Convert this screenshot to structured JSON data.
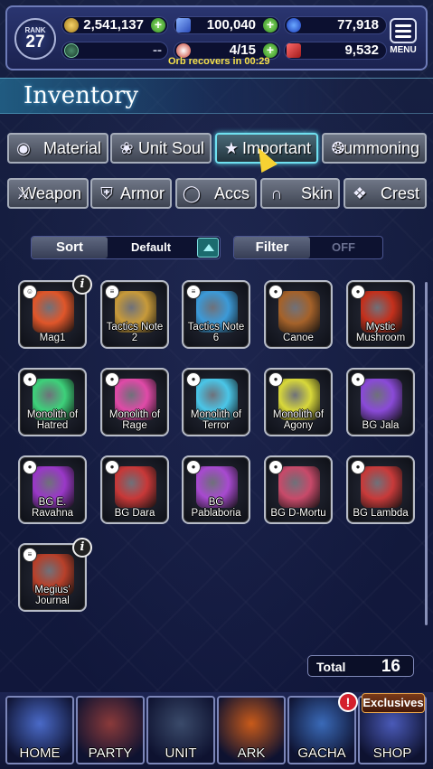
{
  "status": {
    "rank_label": "RANK",
    "rank_value": "27",
    "gil": "2,541,137",
    "gems": "100,040",
    "blue_lapis": "77,918",
    "unit_slot": "--",
    "orbs": "4/15",
    "red_lapis": "9,532",
    "orb_recovery": "Orb recovers in 00:29",
    "menu_label": "MENU"
  },
  "page_title": "Inventory",
  "tabs_row1": [
    {
      "label": "Material",
      "icon": "material-icon"
    },
    {
      "label": "Unit Soul",
      "icon": "unit-soul-icon"
    },
    {
      "label": "Important",
      "icon": "star-icon",
      "active": true
    },
    {
      "label": "Summoning",
      "icon": "summoning-icon"
    }
  ],
  "tabs_row2": [
    {
      "label": "Weapon",
      "icon": "sword-icon"
    },
    {
      "label": "Armor",
      "icon": "armor-icon"
    },
    {
      "label": "Accs",
      "icon": "ring-icon"
    },
    {
      "label": "Skin",
      "icon": "hanger-icon"
    },
    {
      "label": "Crest",
      "icon": "crest-icon"
    }
  ],
  "sort": {
    "label": "Sort",
    "value": "Default"
  },
  "filter": {
    "label": "Filter",
    "value": "OFF"
  },
  "items": [
    {
      "name": "Mag1",
      "color": "#e0562a"
    },
    {
      "name": "Tactics Note 2",
      "color": "#c79a3a"
    },
    {
      "name": "Tactics Note 6",
      "color": "#3c9ad8"
    },
    {
      "name": "Canoe",
      "color": "#a5622a"
    },
    {
      "name": "Mystic Mushroom",
      "color": "#c4301c"
    },
    {
      "name": "Monolith of Hatred",
      "color": "#3dd17a"
    },
    {
      "name": "Monolith of Rage",
      "color": "#e04aa8"
    },
    {
      "name": "Monolith of Terror",
      "color": "#4ac6e8"
    },
    {
      "name": "Monolith of Agony",
      "color": "#d8d83a"
    },
    {
      "name": "BG Jala",
      "color": "#8a4ad8"
    },
    {
      "name": "BG E. Ravahna",
      "color": "#9a38c8"
    },
    {
      "name": "BG Dara",
      "color": "#c83838"
    },
    {
      "name": "BG Pablaboria",
      "color": "#a84ad0"
    },
    {
      "name": "BG D-Mortu",
      "color": "#c84a6a"
    },
    {
      "name": "BG Lambda",
      "color": "#c83a3a"
    },
    {
      "name": "Megius' Journal",
      "color": "#b8402a"
    }
  ],
  "total": {
    "label": "Total",
    "value": "16"
  },
  "nav": [
    {
      "label": "HOME",
      "color": "#4a6ac8"
    },
    {
      "label": "PARTY",
      "color": "#8a3a3a"
    },
    {
      "label": "UNIT",
      "color": "#3a4a6a"
    },
    {
      "label": "ARK",
      "color": "#c85a1a"
    },
    {
      "label": "GACHA",
      "color": "#3a6ab8"
    },
    {
      "label": "SHOP",
      "color": "#4a5ab8"
    }
  ],
  "shop_badge": "Exclusives",
  "gacha_alert": "!"
}
